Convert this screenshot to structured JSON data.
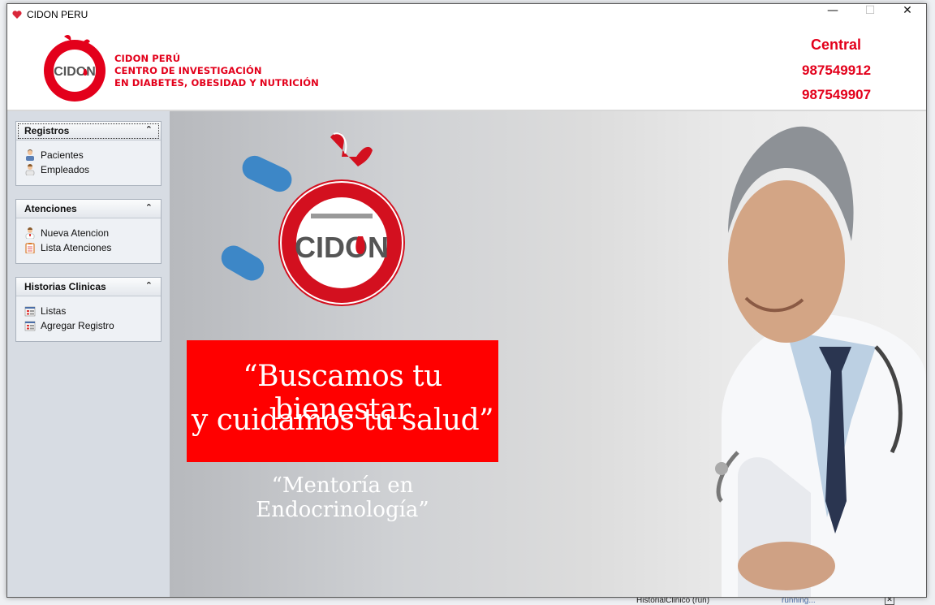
{
  "background": {
    "status_process": "HistorialClinico (run)",
    "status_running": "running..."
  },
  "window": {
    "title": "CIDON PERU",
    "minimize": "—",
    "maximize": "☐",
    "close": "✕"
  },
  "header": {
    "brand_line1": "CIDON PERÚ",
    "brand_line2": "CENTRO DE INVESTIGACIÓN",
    "brand_line3": "EN DIABETES, OBESIDAD Y NUTRICIÓN",
    "central_label": "Central",
    "phone1": "987549912",
    "phone2": "987549907"
  },
  "sidebar": {
    "panels": [
      {
        "title": "Registros",
        "items": [
          {
            "label": "Pacientes",
            "icon": "patients-icon"
          },
          {
            "label": "Empleados",
            "icon": "employee-icon"
          }
        ]
      },
      {
        "title": "Atenciones",
        "items": [
          {
            "label": "Nueva Atencion",
            "icon": "doctor-icon"
          },
          {
            "label": "Lista Atenciones",
            "icon": "clipboard-icon"
          }
        ]
      },
      {
        "title": "Historias Clinicas",
        "items": [
          {
            "label": "Listas",
            "icon": "list-icon"
          },
          {
            "label": "Agregar Registro",
            "icon": "add-record-icon"
          }
        ]
      }
    ],
    "collapse_glyph": "⌃"
  },
  "banner": {
    "logo_text": "CIDON",
    "quote_line1": "“Buscamos tu bienestar",
    "quote_line2": "y cuidamos tu salud”",
    "subtitle": "“Mentoría en Endocrinología”"
  },
  "colors": {
    "brand_red": "#e3001b",
    "banner_red": "#ff0000",
    "sidebar_bg": "#d7dce3"
  }
}
